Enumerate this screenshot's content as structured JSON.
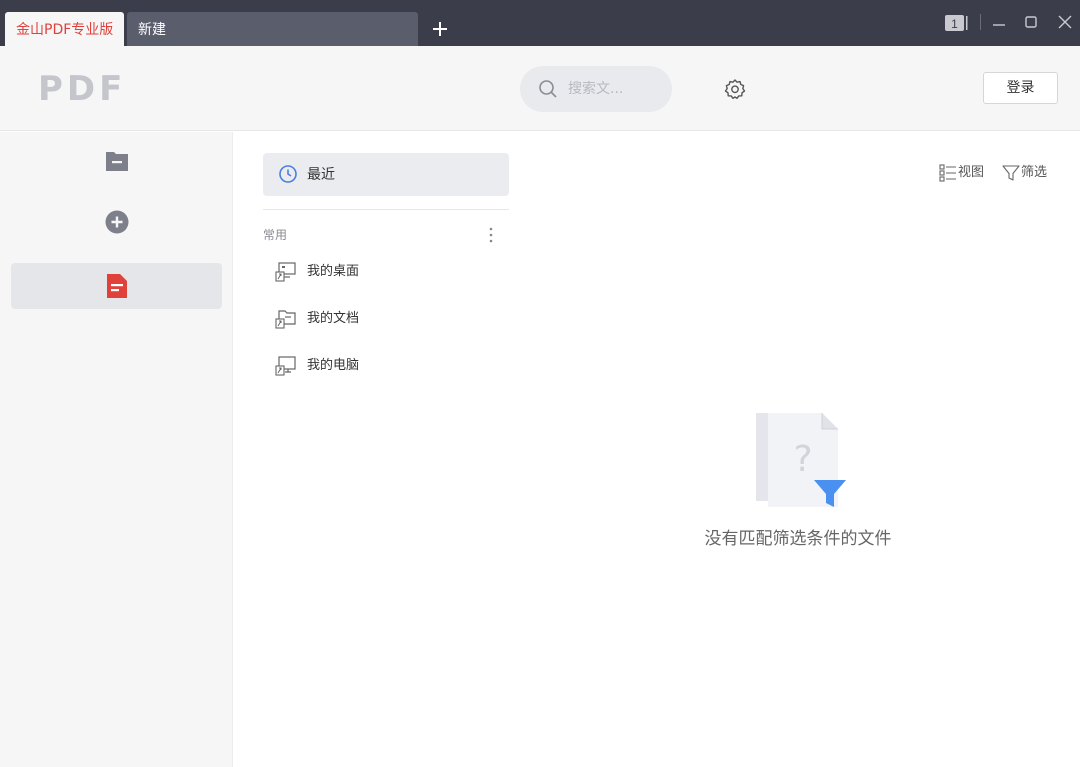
{
  "titlebar": {
    "tabs": [
      {
        "label": "金山PDF专业版",
        "active": true
      },
      {
        "label": "新建",
        "active": false
      }
    ],
    "badge": "1"
  },
  "header": {
    "logo": "PDF",
    "search_placeholder": "搜索文...",
    "login_label": "登录"
  },
  "sidebar": {
    "items": [
      {
        "icon": "folder-icon",
        "active": false
      },
      {
        "icon": "plus-circle-icon",
        "active": false
      },
      {
        "icon": "pdf-document-icon",
        "active": true
      }
    ]
  },
  "nav": {
    "recent_label": "最近",
    "section_label": "常用",
    "items": [
      {
        "label": "我的桌面",
        "icon": "desktop-icon"
      },
      {
        "label": "我的文档",
        "icon": "documents-folder-icon"
      },
      {
        "label": "我的电脑",
        "icon": "computer-icon"
      }
    ]
  },
  "toolbar": {
    "view_label": "视图",
    "filter_label": "筛选"
  },
  "empty_state": {
    "message": "没有匹配筛选条件的文件"
  },
  "colors": {
    "accent_red": "#e0413a",
    "filter_blue": "#4a90f0",
    "titlebar_bg": "#3b3e4a"
  }
}
